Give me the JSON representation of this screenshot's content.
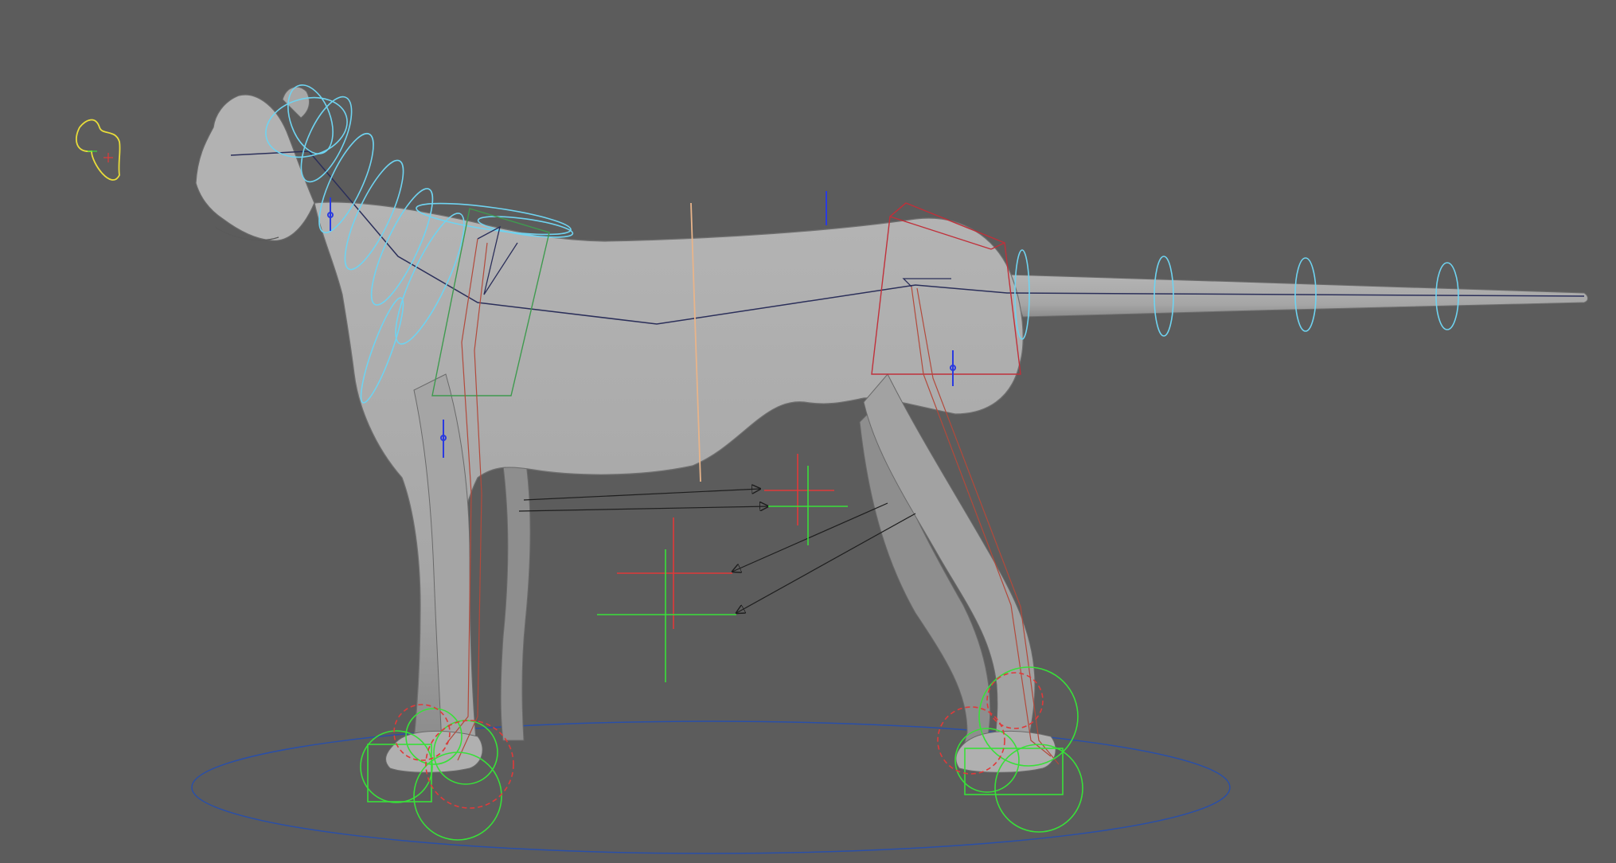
{
  "viewport": {
    "background": "#5c5c5c",
    "model": "quadruped-cat-rig",
    "colors": {
      "body_fill": "#a9a9a9",
      "body_shade": "#8f8f8f",
      "spine_curve": "#2b2f5a",
      "neck_rings": "#6fd3f0",
      "tail_rings": "#6fd3f0",
      "look_at_control": "#e8dc3a",
      "ik_green": "#39e039",
      "ik_red": "#e03a3a",
      "hip_box": "#c0303a",
      "shoulder_box": "#3f9a4f",
      "root_circle": "#2a4fa8",
      "leg_joint_chain": "#b24a3c",
      "center_line": "#e8b48a",
      "pole_vector_blue": "#2a3ae0",
      "pole_arrows": "#1e1e1e"
    },
    "icons": [
      "look-at-control-icon",
      "root-control-icon",
      "ik-handle-icon",
      "pole-vector-icon",
      "fk-ring-icon"
    ]
  }
}
